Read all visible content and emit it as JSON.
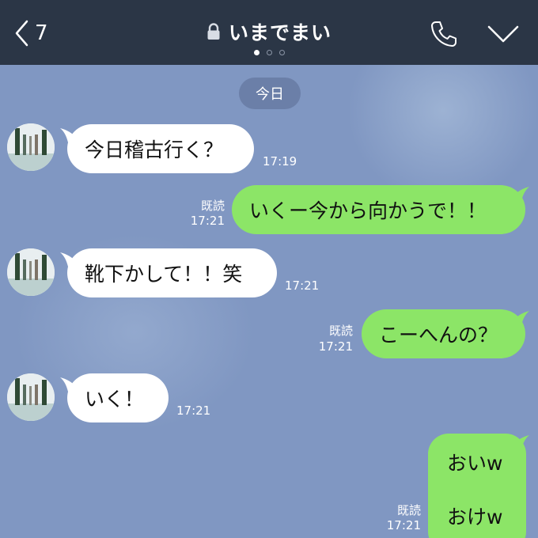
{
  "header": {
    "back_count": "7",
    "title": "いまでまい"
  },
  "date_chip": "今日",
  "messages": [
    {
      "text": "今日稽古行く？",
      "time": "17:19"
    },
    {
      "text": "いくー今から向かうで！！",
      "read": "既読",
      "time": "17:21"
    },
    {
      "text": "靴下かして！！笑",
      "time": "17:21"
    },
    {
      "text": "こーへんの？",
      "read": "既読",
      "time": "17:21"
    },
    {
      "text": "いく！",
      "time": "17:21"
    },
    {
      "lines": [
        "おいw",
        "おけw"
      ],
      "read": "既読",
      "time": "17:21"
    }
  ],
  "colors": {
    "header_bg": "#2b3646",
    "chat_bg": "#8097c2",
    "outgoing_bubble": "#8ce567",
    "incoming_bubble": "#ffffff",
    "date_chip_bg": "#6b7fa8"
  },
  "icons": {
    "back": "chevron-left-icon",
    "lock": "lock-icon",
    "call": "phone-icon",
    "menu": "chevron-down-icon"
  }
}
